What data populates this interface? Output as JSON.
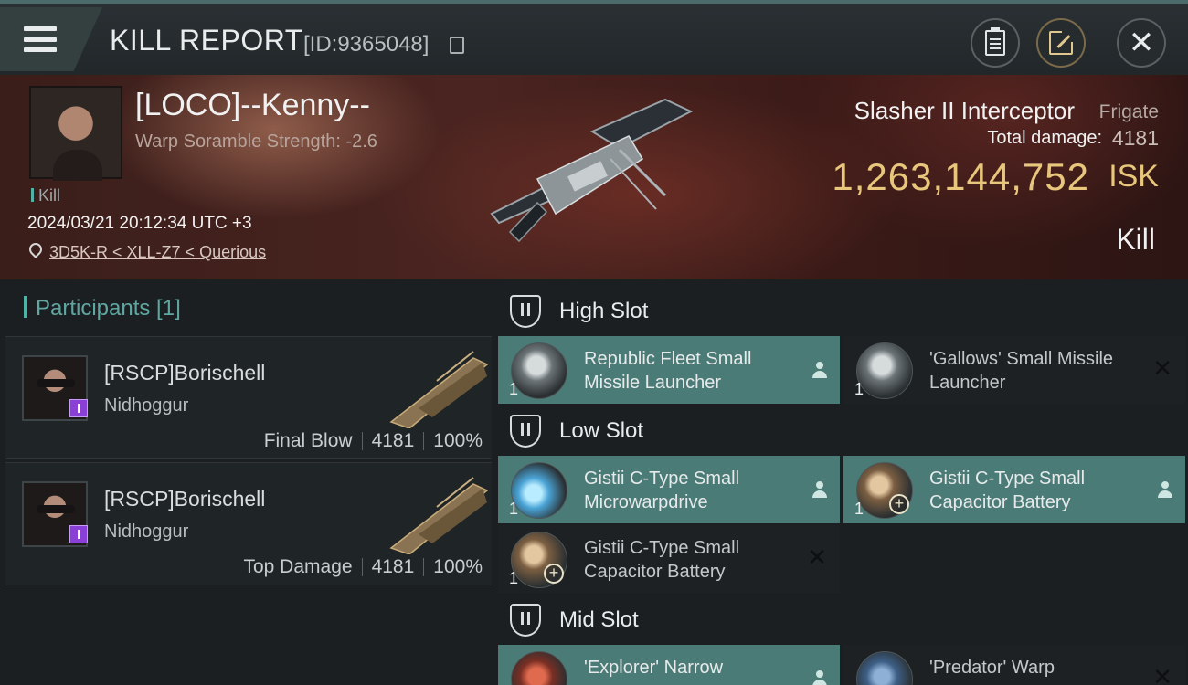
{
  "header": {
    "title": "KILL REPORT",
    "report_id": "[ID:9365048]"
  },
  "victim": {
    "name": "[LOCO]--Kenny--",
    "scramble": "Warp Soramble Strength: -2.6",
    "kill_tag": "Kill",
    "datetime": "2024/03/21 20:12:34 UTC +3",
    "location": "3D5K-R < XLL-Z7 < Querious",
    "ship_name": "Slasher II Interceptor",
    "ship_class": "Frigate",
    "total_damage_label": "Total damage:",
    "total_damage": "4181",
    "isk_value": "1,263,144,752",
    "isk_unit": "ISK",
    "result": "Kill"
  },
  "participants": {
    "heading": "Participants [1]",
    "cards": [
      {
        "name": "[RSCP]Borischell",
        "ship": "Nidhoggur",
        "role": "Final Blow",
        "damage": "4181",
        "percent": "100%"
      },
      {
        "name": "[RSCP]Borischell",
        "ship": "Nidhoggur",
        "role": "Top Damage",
        "damage": "4181",
        "percent": "100%"
      }
    ]
  },
  "slots": {
    "high": {
      "title": "High Slot",
      "modules": [
        {
          "name": "Republic Fleet Small Missile Launcher",
          "qty": "1",
          "state": "dropped"
        },
        {
          "name": "'Gallows' Small Missile Launcher",
          "qty": "1",
          "state": "destroyed"
        }
      ]
    },
    "low": {
      "title": "Low Slot",
      "modules": [
        {
          "name": "Gistii C-Type Small Microwarpdrive",
          "qty": "1",
          "state": "dropped"
        },
        {
          "name": "Gistii C-Type Small Capacitor Battery",
          "qty": "1",
          "state": "dropped"
        },
        {
          "name": "Gistii C-Type Small Capacitor Battery",
          "qty": "1",
          "state": "destroyed"
        }
      ]
    },
    "mid": {
      "title": "Mid Slot",
      "modules": [
        {
          "name": "'Explorer' Narrow",
          "qty": "",
          "state": "dropped"
        },
        {
          "name": "'Predator' Warp",
          "qty": "",
          "state": "destroyed"
        }
      ]
    }
  },
  "icons": {
    "menu": "hamburger-icon",
    "copy": "copy-icon",
    "clipboard": "clipboard-icon",
    "share": "share-icon",
    "close": "close-icon",
    "location": "map-pin-icon",
    "slot": "slot-icon",
    "pilot": "pilot-icon",
    "destroyed": "destroyed-x-icon"
  },
  "colors": {
    "accent_teal": "#4b7b77",
    "isk_gold": "#e8c67b",
    "participants_teal": "#5fa7a0"
  }
}
